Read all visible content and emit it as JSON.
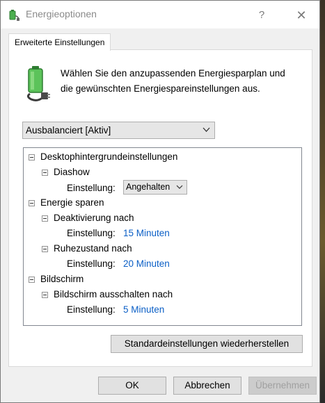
{
  "window": {
    "title": "Energieoptionen",
    "help_glyph": "?",
    "close_glyph": "✕"
  },
  "tab": {
    "label": "Erweiterte Einstellungen"
  },
  "description": "Wählen Sie den anzupassenden Energiesparplan und die gewünschten Energiespareinstellungen aus.",
  "plan_select": {
    "value": "Ausbalanciert [Aktiv]"
  },
  "tree": {
    "desktop_background": "Desktophintergrundeinstellungen",
    "slideshow": "Diashow",
    "slideshow_setting_label": "Einstellung:",
    "slideshow_setting_value": "Angehalten",
    "energy_saving": "Energie sparen",
    "deactivate_after": "Deaktivierung nach",
    "deactivate_setting_label": "Einstellung:",
    "deactivate_setting_value": "15 Minuten",
    "sleep_after": "Ruhezustand nach",
    "sleep_setting_label": "Einstellung:",
    "sleep_setting_value": "20 Minuten",
    "display": "Bildschirm",
    "display_off_after": "Bildschirm ausschalten nach",
    "display_setting_label": "Einstellung:",
    "display_setting_value": "5 Minuten"
  },
  "buttons": {
    "restore_defaults": "Standardeinstellungen wiederherstellen",
    "ok": "OK",
    "cancel": "Abbrechen",
    "apply": "Übernehmen"
  },
  "colors": {
    "value_link": "#0b5fc6",
    "dialog_bg": "#f0f0f0",
    "battery_green": "#3fae49"
  }
}
